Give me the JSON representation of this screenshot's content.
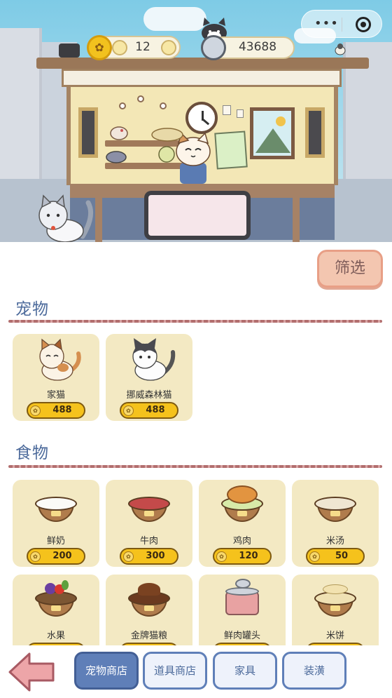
{
  "hud": {
    "coins": "12",
    "cans": "43688"
  },
  "panel": {
    "filter_label": "筛选",
    "sections": {
      "pets": {
        "title": "宠物",
        "items": [
          {
            "name": "家猫",
            "price": "488",
            "icon": "calico-cat"
          },
          {
            "name": "挪威森林猫",
            "price": "488",
            "icon": "tuxedo-cat"
          }
        ]
      },
      "food": {
        "title": "食物",
        "items": [
          {
            "name": "鲜奶",
            "price": "200",
            "icon": "milk-bowl"
          },
          {
            "name": "牛肉",
            "price": "300",
            "icon": "beef-bowl"
          },
          {
            "name": "鸡肉",
            "price": "120",
            "icon": "chicken-bowl"
          },
          {
            "name": "米汤",
            "price": "50",
            "icon": "rice-soup-bowl"
          },
          {
            "name": "水果",
            "price": "",
            "icon": "fruit-bowl"
          },
          {
            "name": "金牌猫粮",
            "price": "",
            "icon": "cat-food-bowl"
          },
          {
            "name": "鲜肉罐头",
            "price": "",
            "icon": "meat-can"
          },
          {
            "name": "米饼",
            "price": "",
            "icon": "rice-cake-bowl"
          }
        ]
      }
    }
  },
  "nav": {
    "tabs": [
      {
        "label": "宠物商店"
      },
      {
        "label": "道具商店"
      },
      {
        "label": "家具"
      },
      {
        "label": "装潢"
      }
    ]
  },
  "colors": {
    "accent_blue": "#5f7fb8",
    "card_bg": "#f3e9c3",
    "price_gold": "#f5c21c",
    "filter_bg": "#f3c6b0",
    "back_arrow": "#eda5a8"
  }
}
